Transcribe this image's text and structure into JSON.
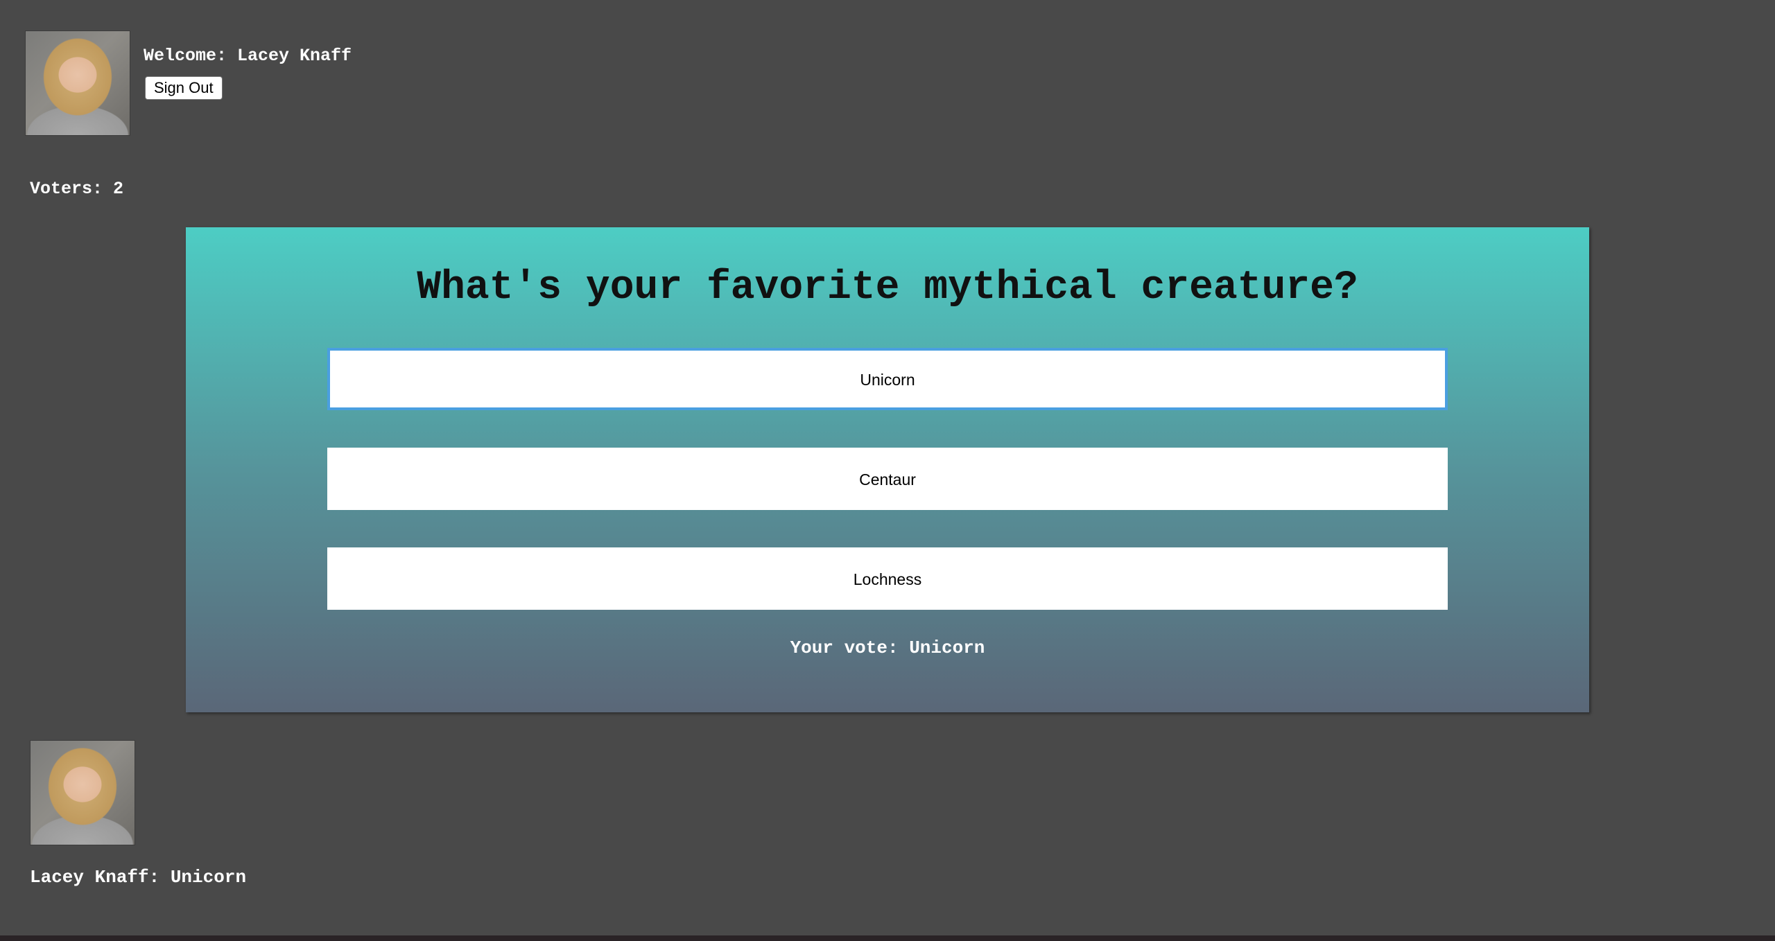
{
  "header": {
    "welcome_text": "Welcome: Lacey Knaff",
    "sign_out_label": "Sign Out",
    "avatar_icon": "user-photo"
  },
  "voters_text": "Voters: 2",
  "poll": {
    "question": "What's your favorite mythical creature?",
    "options": [
      {
        "label": "Unicorn",
        "selected": true
      },
      {
        "label": "Centaur",
        "selected": false
      },
      {
        "label": "Lochness",
        "selected": false
      }
    ],
    "your_vote_text": "Your vote: Unicorn",
    "gradient_colors": [
      "#4dcdc4",
      "#5a6778"
    ],
    "selection_color": "#4a9fe0"
  },
  "results": [
    {
      "text": "Lacey Knaff: Unicorn",
      "avatar_icon": "user-photo"
    }
  ],
  "colors": {
    "page_background": "#494949",
    "text": "#ffffff"
  }
}
